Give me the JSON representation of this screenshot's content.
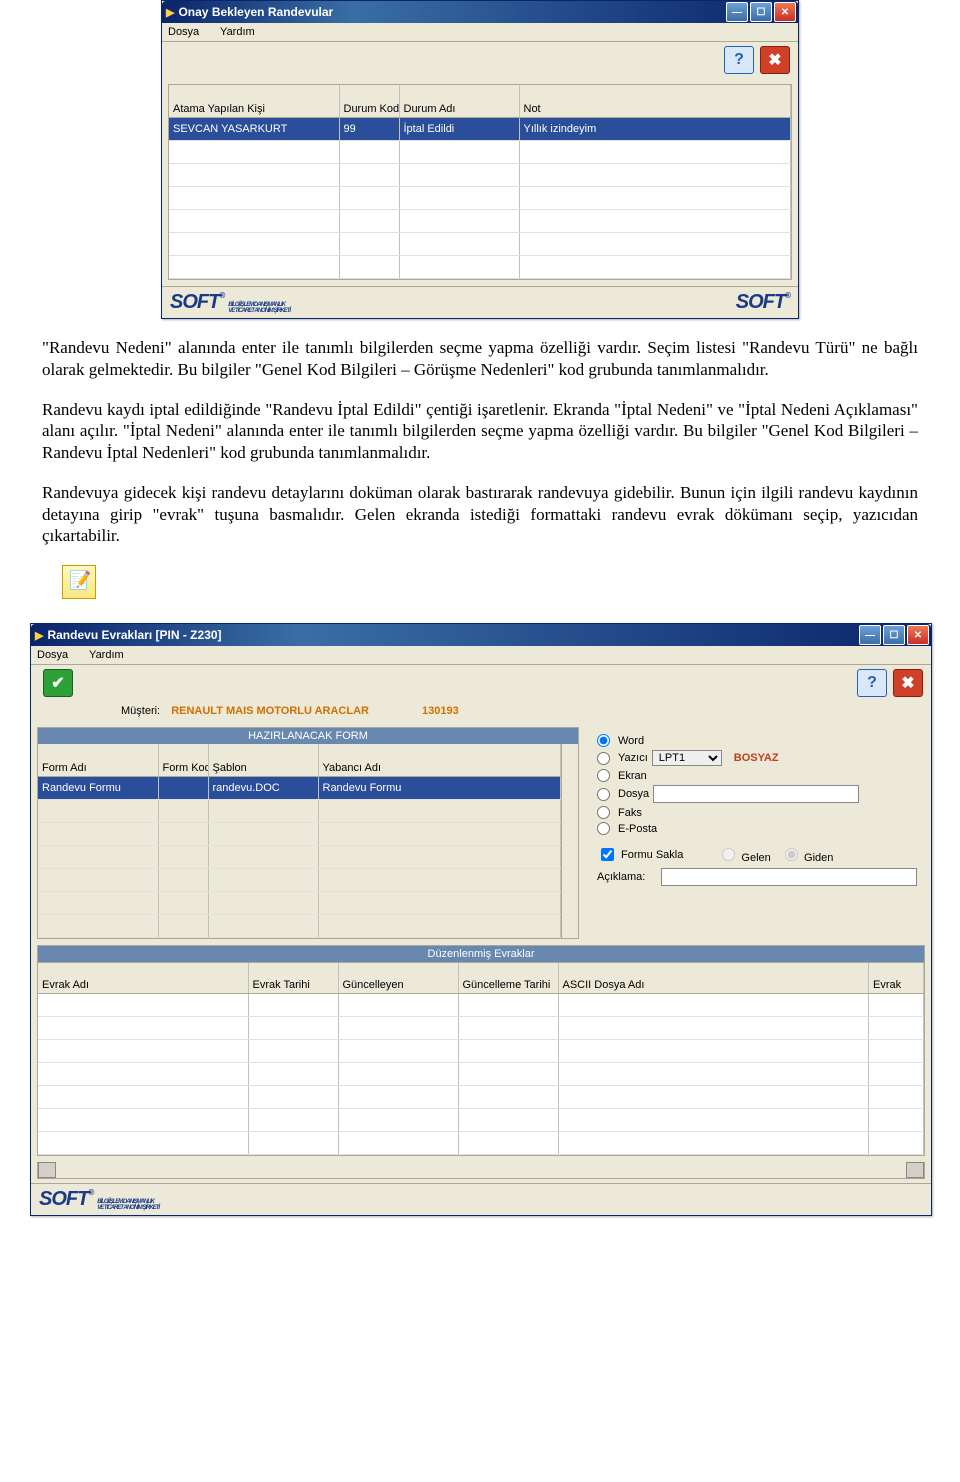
{
  "window1": {
    "title": "Onay Bekleyen Randevular",
    "menu": {
      "file": "Dosya",
      "help": "Yardım"
    },
    "tools": {
      "help_icon": "?",
      "close_icon": "✖"
    },
    "table": {
      "headers": {
        "assignee": "Atama Yapılan Kişi",
        "status_code": "Durum Kodu",
        "status_name": "Durum Adı",
        "note": "Not"
      },
      "row": {
        "assignee": "SEVCAN YASARKURT",
        "status_code": "99",
        "status_name": "İptal Edildi",
        "note": "Yıllık izindeyim"
      }
    },
    "footer": {
      "soft": "SOFT",
      "reg": "®",
      "sub1": "BİLGİ İŞLEM DANIŞMANLIK",
      "sub2": "VE TİCARET ANONİM ŞİRKETİ"
    }
  },
  "paragraphs": {
    "p1": "\"Randevu Nedeni\" alanında enter ile tanımlı bilgilerden seçme yapma özelliği vardır. Seçim listesi \"Randevu Türü\" ne bağlı olarak gelmektedir. Bu bilgiler \"Genel Kod Bilgileri – Görüşme Nedenleri\" kod grubunda tanımlanmalıdır.",
    "p2": "Randevu kaydı iptal edildiğinde \"Randevu İptal Edildi\" çentiği işaretlenir. Ekranda \"İptal Nedeni\" ve \"İptal Nedeni Açıklaması\" alanı açılır. \"İptal Nedeni\" alanında enter ile tanımlı bilgilerden seçme yapma özelliği vardır. Bu bilgiler \"Genel Kod Bilgileri – Randevu İptal Nedenleri\" kod grubunda tanımlanmalıdır.",
    "p3": "Randevuya gidecek kişi randevu detaylarını doküman olarak bastırarak randevuya gidebilir. Bunun için ilgili randevu kaydının detayına girip \"evrak\" tuşuna basmalıdır. Gelen ekranda istediği formattaki randevu evrak dökümanı seçip, yazıcıdan çıkartabilir."
  },
  "window2": {
    "title": "Randevu Evrakları [PIN - Z230]",
    "menu": {
      "file": "Dosya",
      "help": "Yardım"
    },
    "tools": {
      "ok_icon": "✔",
      "help_icon": "?",
      "close_icon": "✖"
    },
    "customer": {
      "label": "Müşteri:",
      "value": "RENAULT MAIS MOTORLU ARACLAR",
      "code": "130193"
    },
    "form_section": {
      "title": "HAZIRLANACAK FORM",
      "headers": {
        "name": "Form Adı",
        "code": "Form Kodu",
        "template": "Şablon",
        "foreign": "Yabancı Adı"
      },
      "row": {
        "name": "Randevu Formu",
        "code": "",
        "template": "randevu.DOC",
        "foreign": "Randevu Formu"
      }
    },
    "output": {
      "word": "Word",
      "printer": "Yazıcı",
      "printer_value": "LPT1",
      "bosyaz": "BOSYAZ",
      "screen": "Ekran",
      "file": "Dosya",
      "fax": "Faks",
      "email": "E-Posta",
      "save_form": "Formu Sakla",
      "incoming": "Gelen",
      "outgoing": "Giden",
      "explanation": "Açıklama:"
    },
    "edited_section": {
      "title": "Düzenlenmiş Evraklar",
      "headers": {
        "name": "Evrak Adı",
        "date": "Evrak Tarihi",
        "updater": "Güncelleyen",
        "update_date": "Güncelleme Tarihi",
        "ascii": "ASCII Dosya Adı",
        "evrak": "Evrak"
      }
    },
    "footer": {
      "soft": "SOFT",
      "reg": "®",
      "sub1": "BİLGİ İŞLEM DANIŞMANLIK",
      "sub2": "VE TİCARET ANONİM ŞİRKETİ"
    }
  }
}
